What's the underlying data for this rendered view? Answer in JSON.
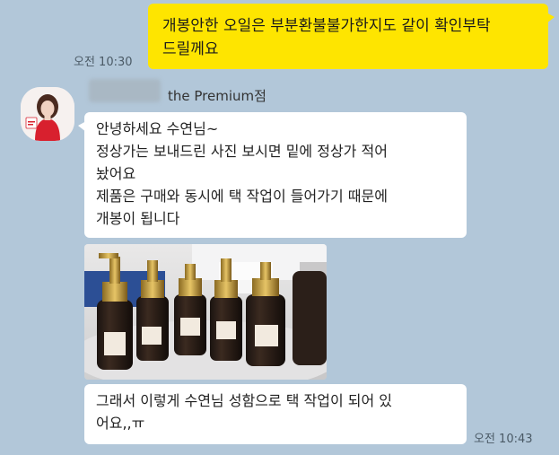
{
  "messages": {
    "sent": {
      "lines": [
        "개봉안한 오일은 부분환불불가한지도 같이 확인부탁",
        "드릴께요"
      ],
      "time": "오전 10:30"
    },
    "received": {
      "sender_suffix": "the Premium점",
      "bubble1_lines": [
        "안녕하세요 수연님~",
        "정상가는 보내드린 사진 보시면 밑에 정상가 적어",
        "놨어요",
        "제품은 구매와 동시에 택 작업이 들어가기 때문에",
        "개봉이 됩니다"
      ],
      "bubble2_lines": [
        "그래서 이렇게 수연님 성함으로 택 작업이 되어 있",
        "어요,,ㅠ"
      ],
      "time": "오전 10:43"
    }
  },
  "colors": {
    "background": "#b2c7d9",
    "sent_bubble": "#fee500",
    "received_bubble": "#ffffff"
  }
}
